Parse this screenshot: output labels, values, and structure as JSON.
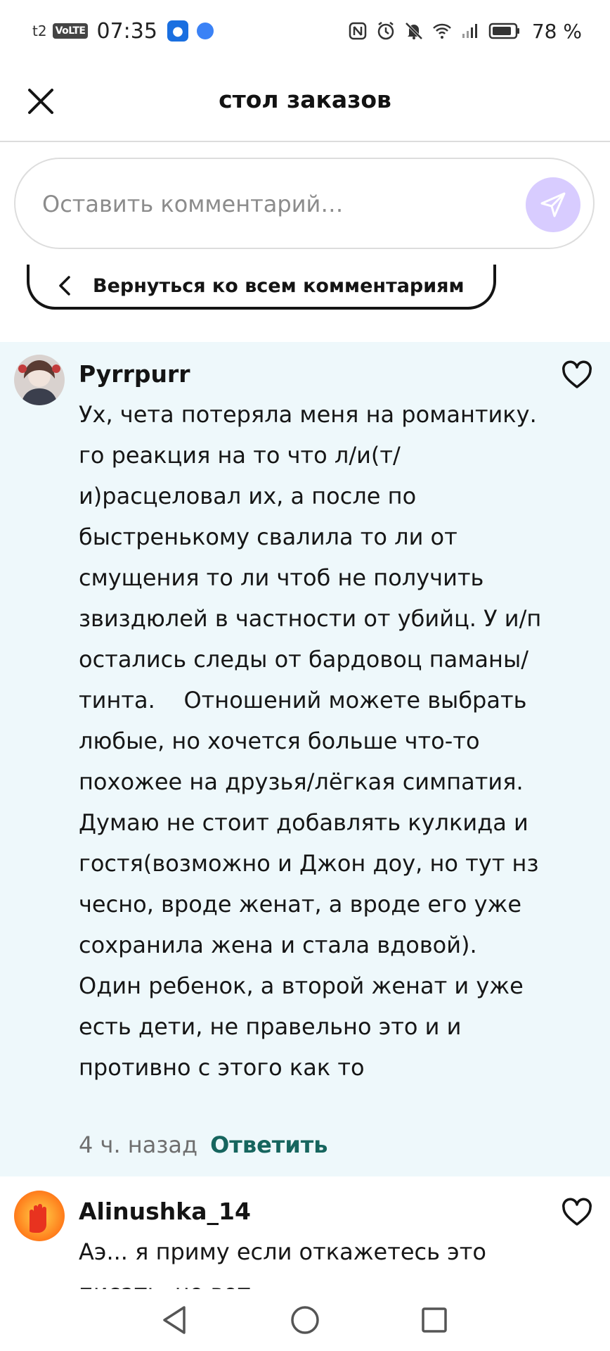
{
  "status_bar": {
    "carrier": "t2",
    "network_badge": "VoLTE",
    "time": "07:35",
    "battery_percent": "78 %",
    "icons": [
      "nfc-icon",
      "alarm-icon",
      "mute-icon",
      "wifi-icon",
      "signal-icon",
      "battery-icon"
    ]
  },
  "header": {
    "title": "стол заказов",
    "close_icon": "close-icon"
  },
  "comment_input": {
    "placeholder": "Оставить комментарий…",
    "send_icon": "send-icon",
    "send_color": "#d8ccff"
  },
  "back_button": {
    "label": "Вернуться ко всем комментариям"
  },
  "comments": [
    {
      "username": "Pyrrpurr",
      "text": "Ух, чета потеряла меня на романтику. го реакция на то что л/и(т/и)расцеловал их, а после по быстренькому свалила то ли от смущения то ли чтоб не получить звиздюлей в частности от убийц. У и/п остались следы от бардовоц паманы/тинта.    Отношений можете выбрать любые, но хочется больше что-то похожее на друзья/лёгкая симпатия.\nДумаю не стоит добавлять кулкида и гостя(возможно и Джон доу, но тут нз чесно, вроде женат, а вроде его уже сохранила жена и стала вдовой). Один ребенок, а второй женат и уже есть дети, не правельно это и и противно с этого как то",
      "time_ago": "4 ч. назад",
      "reply_label": "Ответить",
      "highlighted": true
    },
    {
      "username": "Alinushka_14",
      "text": "Аэ... я приму если откажетесь это писать, но вот",
      "highlighted": false
    }
  ],
  "colors": {
    "highlight_bg": "#eef8fb",
    "reply_green": "#16655e"
  }
}
